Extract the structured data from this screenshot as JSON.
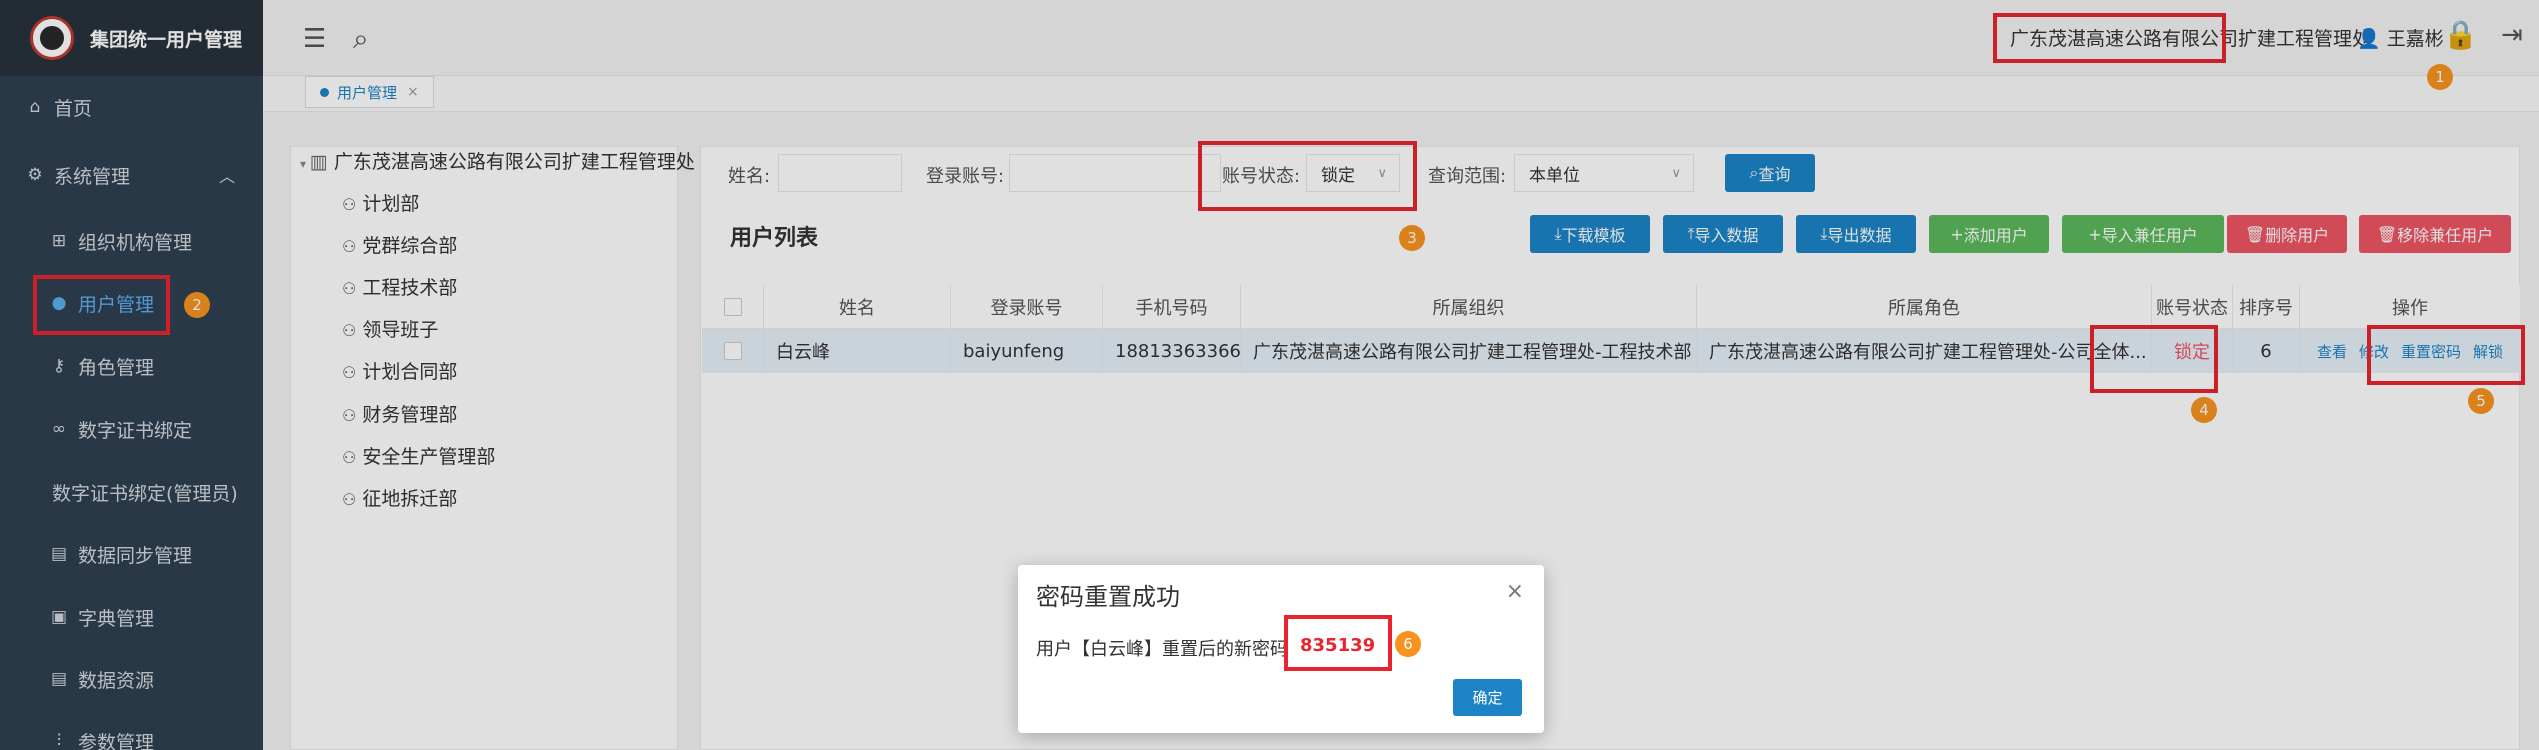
{
  "app": {
    "title": "集团统一用户管理"
  },
  "sidebar": {
    "home": "首页",
    "system": "系统管理",
    "items": [
      {
        "label": "组织机构管理"
      },
      {
        "label": "用户管理"
      },
      {
        "label": "角色管理"
      },
      {
        "label": "数字证书绑定"
      },
      {
        "label": "数字证书绑定(管理员)"
      },
      {
        "label": "数据同步管理"
      },
      {
        "label": "字典管理"
      },
      {
        "label": "数据资源"
      },
      {
        "label": "参数管理"
      }
    ]
  },
  "header": {
    "org": "广东茂湛高速公路有限公司扩建工程管理处",
    "user": "王嘉彬"
  },
  "tabs": [
    {
      "label": "用户管理"
    }
  ],
  "tree": {
    "root": "广东茂湛高速公路有限公司扩建工程管理处",
    "nodes": [
      "计划部",
      "党群综合部",
      "工程技术部",
      "领导班子",
      "计划合同部",
      "财务管理部",
      "安全生产管理部",
      "征地拆迁部"
    ]
  },
  "filters": {
    "name_label": "姓名:",
    "account_label": "登录账号:",
    "status_label": "账号状态:",
    "status_value": "锁定",
    "scope_label": "查询范围:",
    "scope_value": "本单位",
    "query_btn": "查询"
  },
  "list": {
    "title": "用户列表",
    "buttons": {
      "download": "下载模板",
      "import": "导入数据",
      "export": "导出数据",
      "add": "添加用户",
      "import_part": "导入兼任用户",
      "delete": "删除用户",
      "remove_part": "移除兼任用户"
    },
    "columns": [
      "姓名",
      "登录账号",
      "手机号码",
      "所属组织",
      "所属角色",
      "账号状态",
      "排序号",
      "操作"
    ],
    "rows": [
      {
        "name": "白云峰",
        "account": "baiyunfeng",
        "phone": "18813363366",
        "org": "广东茂湛高速公路有限公司扩建工程管理处-工程技术部",
        "role": "广东茂湛高速公路有限公司扩建工程管理处-公司全体...",
        "status": "锁定",
        "order": "6",
        "actions": {
          "view": "查看",
          "edit": "修改",
          "reset": "重置密码",
          "unlock": "解锁"
        }
      }
    ]
  },
  "badges": [
    "1",
    "2",
    "3",
    "4",
    "5",
    "6"
  ],
  "modal": {
    "title": "密码重置成功",
    "message": "用户【白云峰】重置后的新密码",
    "password": "835139",
    "ok": "确定"
  },
  "colors": {
    "sidebar": "#2f4050",
    "primary": "#1c84c6",
    "annotation": "#e8252e",
    "badge": "#f7931e"
  }
}
